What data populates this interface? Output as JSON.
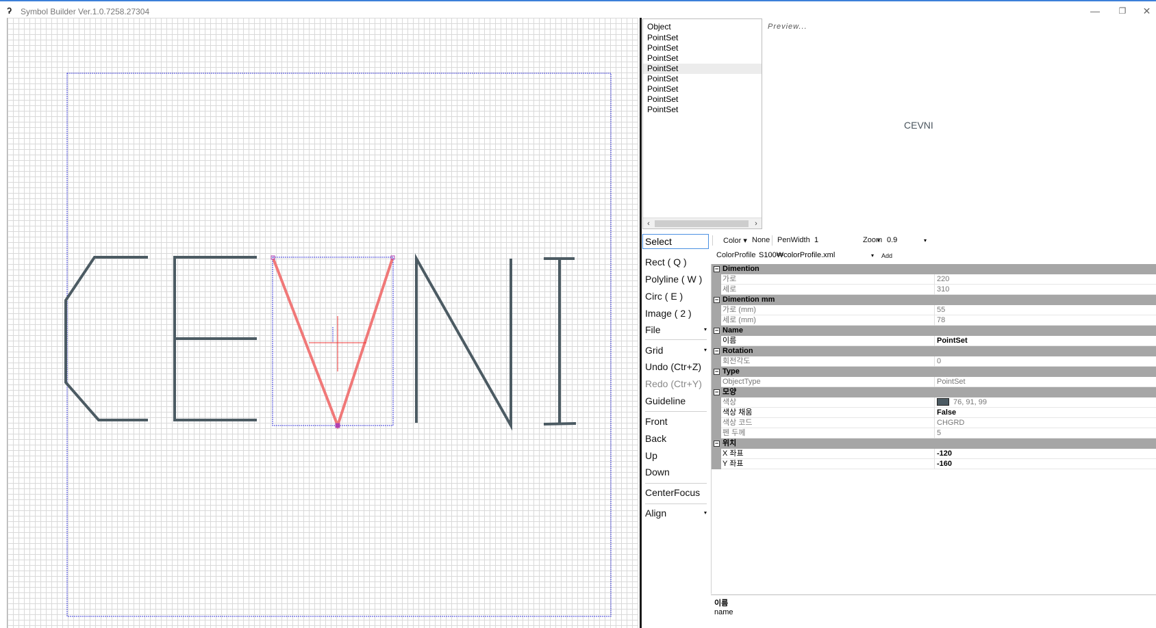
{
  "window": {
    "title": "Symbol Builder Ver.1.0.7258.27304",
    "controls": {
      "minimize": "—",
      "restore": "❐",
      "close": "✕"
    }
  },
  "canvas": {
    "stroke_color": "#4c5b63",
    "selection_color": "#f07878",
    "bounds_color": "#3a3ad9"
  },
  "object_list": {
    "header": "Object",
    "items": [
      "PointSet",
      "PointSet",
      "PointSet",
      "PointSet",
      "PointSet",
      "PointSet",
      "PointSet",
      "PointSet"
    ],
    "selected_index": 3,
    "scroll_left": "‹",
    "scroll_right": "›"
  },
  "preview": {
    "label": "Preview...",
    "text": "CEVNI"
  },
  "tools": {
    "select": "Select",
    "rect": "Rect ( Q )",
    "polyline": "Polyline  ( W )",
    "circ": "Circ  ( E )",
    "image": "Image  ( 2 )",
    "file": "File",
    "grid": "Grid",
    "undo": "Undo (Ctr+Z)",
    "redo": "Redo (Ctr+Y)",
    "guideline": "Guideline",
    "front": "Front",
    "back": "Back",
    "up": "Up",
    "down": "Down",
    "centerfocus": "CenterFocus",
    "align": "Align",
    "dropdown_glyph": "▾"
  },
  "toolbar": {
    "color_label": "Color ▾",
    "color_value": "None",
    "penwidth_label": "PenWidth",
    "penwidth_value": "1",
    "zoom_label": "Zoom",
    "zoom_value": "0.9",
    "colorprofile_label": "ColorProfile",
    "colorprofile_value": "S100₩colorProfile.xml",
    "add_label": "Add",
    "dropdown_glyph": "▾"
  },
  "property_grid": {
    "categories": [
      {
        "name": "Dimention",
        "props": [
          {
            "name": "가로",
            "value": "220"
          },
          {
            "name": "세로",
            "value": "310"
          }
        ]
      },
      {
        "name": "Dimention mm",
        "props": [
          {
            "name": "가로 (mm)",
            "value": "55"
          },
          {
            "name": "세로 (mm)",
            "value": "78"
          }
        ]
      },
      {
        "name": "Name",
        "props": [
          {
            "name": "이름",
            "value": "PointSet",
            "bold": true
          }
        ]
      },
      {
        "name": "Rotation",
        "props": [
          {
            "name": "회전각도",
            "value": "0"
          }
        ]
      },
      {
        "name": "Type",
        "props": [
          {
            "name": "ObjectType",
            "value": "PointSet"
          }
        ]
      },
      {
        "name": "모양",
        "props": [
          {
            "name": "색상",
            "value": "76, 91, 99",
            "swatch": true
          },
          {
            "name": "색상 채움",
            "value": "False",
            "bold": true
          },
          {
            "name": "색상 코드",
            "value": "CHGRD"
          },
          {
            "name": "펜 두께",
            "value": "5"
          }
        ]
      },
      {
        "name": "위치",
        "props": [
          {
            "name": "X 좌표",
            "value": "-120",
            "bold": true
          },
          {
            "name": "Y 좌표",
            "value": "-160",
            "bold": true
          }
        ]
      }
    ],
    "toggle_glyph": "−"
  },
  "description": {
    "title": "이름",
    "text": "name"
  }
}
